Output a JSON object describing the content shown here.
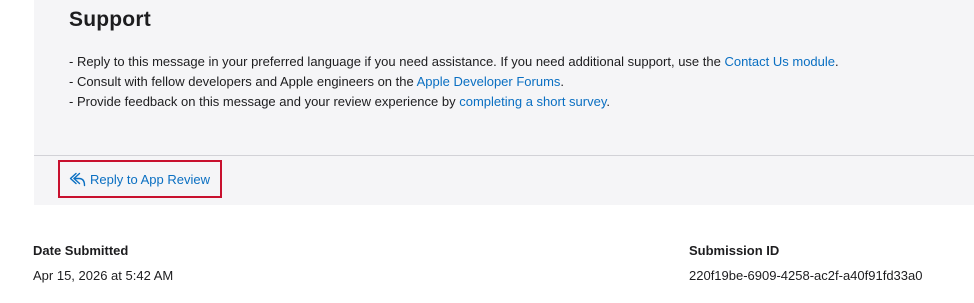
{
  "support": {
    "title": "Support",
    "line1_prefix": "- Reply to this message in your preferred language if you need assistance. If you need additional support, use the ",
    "line1_link": "Contact Us module",
    "line1_suffix": ".",
    "line2_prefix": "- Consult with fellow developers and Apple engineers on the ",
    "line2_link": "Apple Developer Forums",
    "line2_suffix": ".",
    "line3_prefix": "- Provide feedback on this message and your review experience by ",
    "line3_link": "completing a short survey",
    "line3_suffix": "."
  },
  "reply": {
    "label": "Reply to App Review",
    "icon": "reply-arrow-icon"
  },
  "details": {
    "date_label": "Date Submitted",
    "date_value": "Apr 15, 2026 at 5:42 AM",
    "submission_label": "Submission ID",
    "submission_value": "220f19be-6909-4258-ac2f-a40f91fd33a0"
  },
  "colors": {
    "link": "#0a6fc2",
    "highlight_border": "#c8102e",
    "panel_bg": "#f5f5f7"
  }
}
